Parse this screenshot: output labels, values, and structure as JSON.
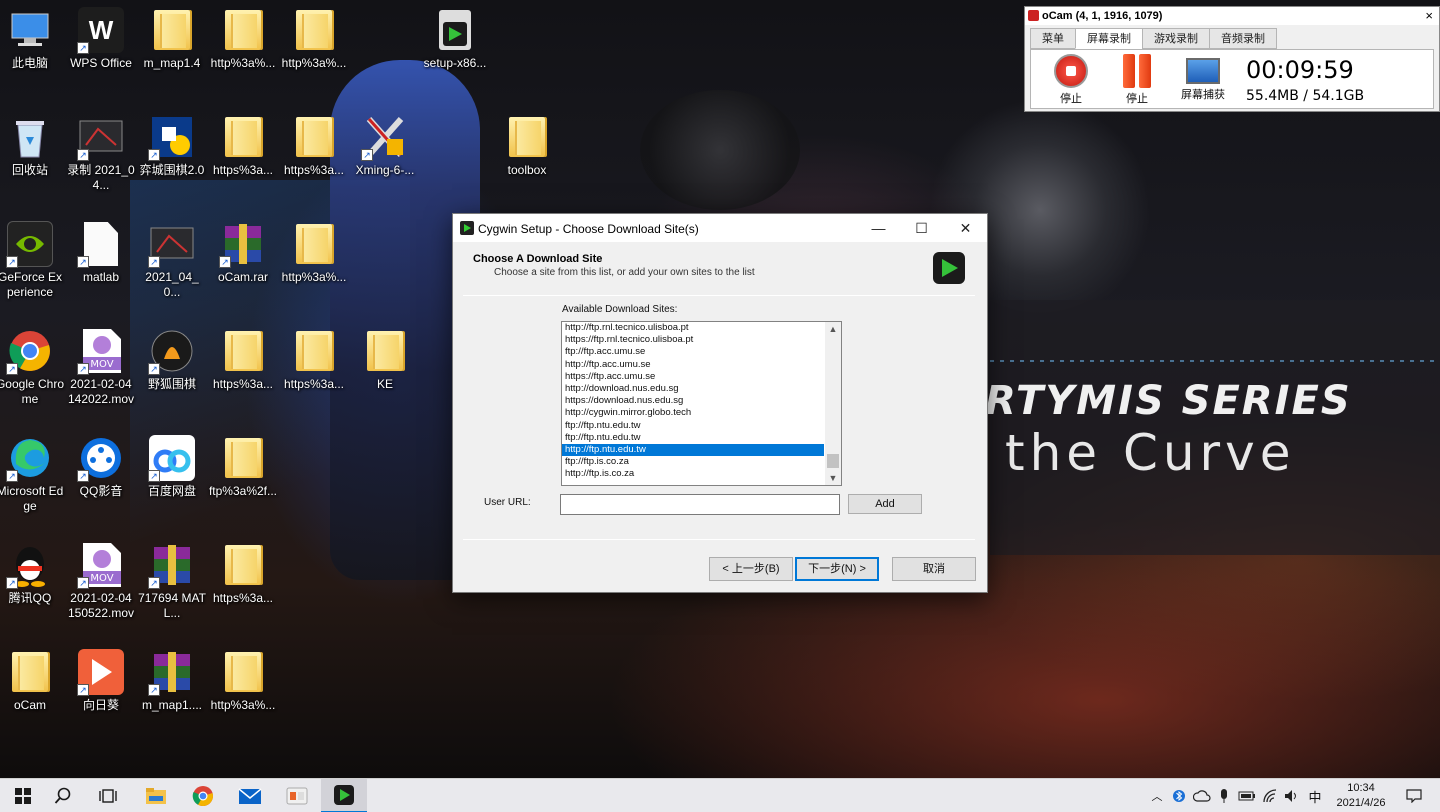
{
  "desktop": {
    "wallpaper": {
      "title": "RTYMIS SERIES",
      "subtitle": "the Curve"
    },
    "icons": [
      {
        "label": "此电脑",
        "icon": "computer-icon"
      },
      {
        "label": "WPS Office",
        "icon": "wps-icon"
      },
      {
        "label": "m_map1.4",
        "icon": "folder-icon"
      },
      {
        "label": "http%3a%...",
        "icon": "folder-icon"
      },
      {
        "label": "http%3a%...",
        "icon": "folder-icon"
      },
      {
        "label": "setup-x86...",
        "icon": "cygwin-installer-icon"
      },
      {
        "label": "回收站",
        "icon": "recycle-bin-icon"
      },
      {
        "label": "录制 2021_04...",
        "icon": "video-file-icon"
      },
      {
        "label": "弈城围棋2.0",
        "icon": "go-game-icon"
      },
      {
        "label": "https%3a...",
        "icon": "folder-icon"
      },
      {
        "label": "https%3a...",
        "icon": "folder-icon"
      },
      {
        "label": "Xming-6-...",
        "icon": "xming-icon"
      },
      {
        "label": "toolbox",
        "icon": "folder-icon"
      },
      {
        "label": "GeForce Experience",
        "icon": "nvidia-icon"
      },
      {
        "label": "matlab",
        "icon": "file-icon"
      },
      {
        "label": "2021_04_0...",
        "icon": "video-file-icon"
      },
      {
        "label": "oCam.rar",
        "icon": "winrar-icon"
      },
      {
        "label": "http%3a%...",
        "icon": "folder-icon"
      },
      {
        "label": "Google Chrome",
        "icon": "chrome-icon"
      },
      {
        "label": "2021-02-04 142022.mov",
        "icon": "mov-file-icon"
      },
      {
        "label": "野狐围棋",
        "icon": "foxwq-icon"
      },
      {
        "label": "https%3a...",
        "icon": "folder-icon"
      },
      {
        "label": "https%3a...",
        "icon": "folder-icon"
      },
      {
        "label": "KE",
        "icon": "folder-icon"
      },
      {
        "label": "Microsoft Edge",
        "icon": "edge-icon"
      },
      {
        "label": "QQ影音",
        "icon": "qqplayer-icon"
      },
      {
        "label": "百度网盘",
        "icon": "baidu-netdisk-icon"
      },
      {
        "label": "ftp%3a%2f...",
        "icon": "folder-icon"
      },
      {
        "label": "腾讯QQ",
        "icon": "qq-icon"
      },
      {
        "label": "2021-02-04 150522.mov",
        "icon": "mov-file-icon"
      },
      {
        "label": "717694 MATL...",
        "icon": "winrar-icon"
      },
      {
        "label": "https%3a...",
        "icon": "folder-icon"
      },
      {
        "label": "oCam",
        "icon": "folder-icon"
      },
      {
        "label": "向日葵",
        "icon": "sunlogin-icon"
      },
      {
        "label": "m_map1....",
        "icon": "winrar-icon"
      },
      {
        "label": "http%3a%...",
        "icon": "folder-icon"
      }
    ]
  },
  "ocam": {
    "title": "oCam (4, 1, 1916, 1079)",
    "close": "×",
    "tabs": [
      "菜单",
      "屏幕录制",
      "游戏录制",
      "音频录制"
    ],
    "active_tab": "屏幕录制",
    "buttons": {
      "stop_record": "停止",
      "pause": "停止",
      "capture": "屏幕捕获"
    },
    "time": "00:09:59",
    "size": "55.4MB / 54.1GB"
  },
  "dialog": {
    "title": "Cygwin Setup - Choose Download Site(s)",
    "minimize": "—",
    "maximize": "☐",
    "close": "✕",
    "heading": "Choose A Download Site",
    "subheading": "Choose a site from this list, or add your own sites to the list",
    "sites_label": "Available Download Sites:",
    "sites": [
      "http://ftp.rnl.tecnico.ulisboa.pt",
      "https://ftp.rnl.tecnico.ulisboa.pt",
      "ftp://ftp.acc.umu.se",
      "http://ftp.acc.umu.se",
      "https://ftp.acc.umu.se",
      "http://download.nus.edu.sg",
      "https://download.nus.edu.sg",
      "http://cygwin.mirror.globo.tech",
      "ftp://ftp.ntu.edu.tw",
      "ftp://ftp.ntu.edu.tw",
      "http://ftp.ntu.edu.tw",
      "ftp://ftp.is.co.za",
      "http://ftp.is.co.za"
    ],
    "selected_site": "http://ftp.ntu.edu.tw",
    "url_label": "User URL:",
    "url_value": "",
    "add_button": "Add",
    "back_button": "< 上一步(B)",
    "next_button": "下一步(N) >",
    "cancel_button": "取消"
  },
  "taskbar": {
    "apps": [
      "start-icon",
      "search-icon",
      "task-view-icon",
      "file-explorer-icon",
      "chrome-icon",
      "mail-icon",
      "app-icon",
      "cygwin-icon"
    ],
    "tray": {
      "ime": "中",
      "time": "10:34",
      "date": "2021/4/26"
    }
  }
}
